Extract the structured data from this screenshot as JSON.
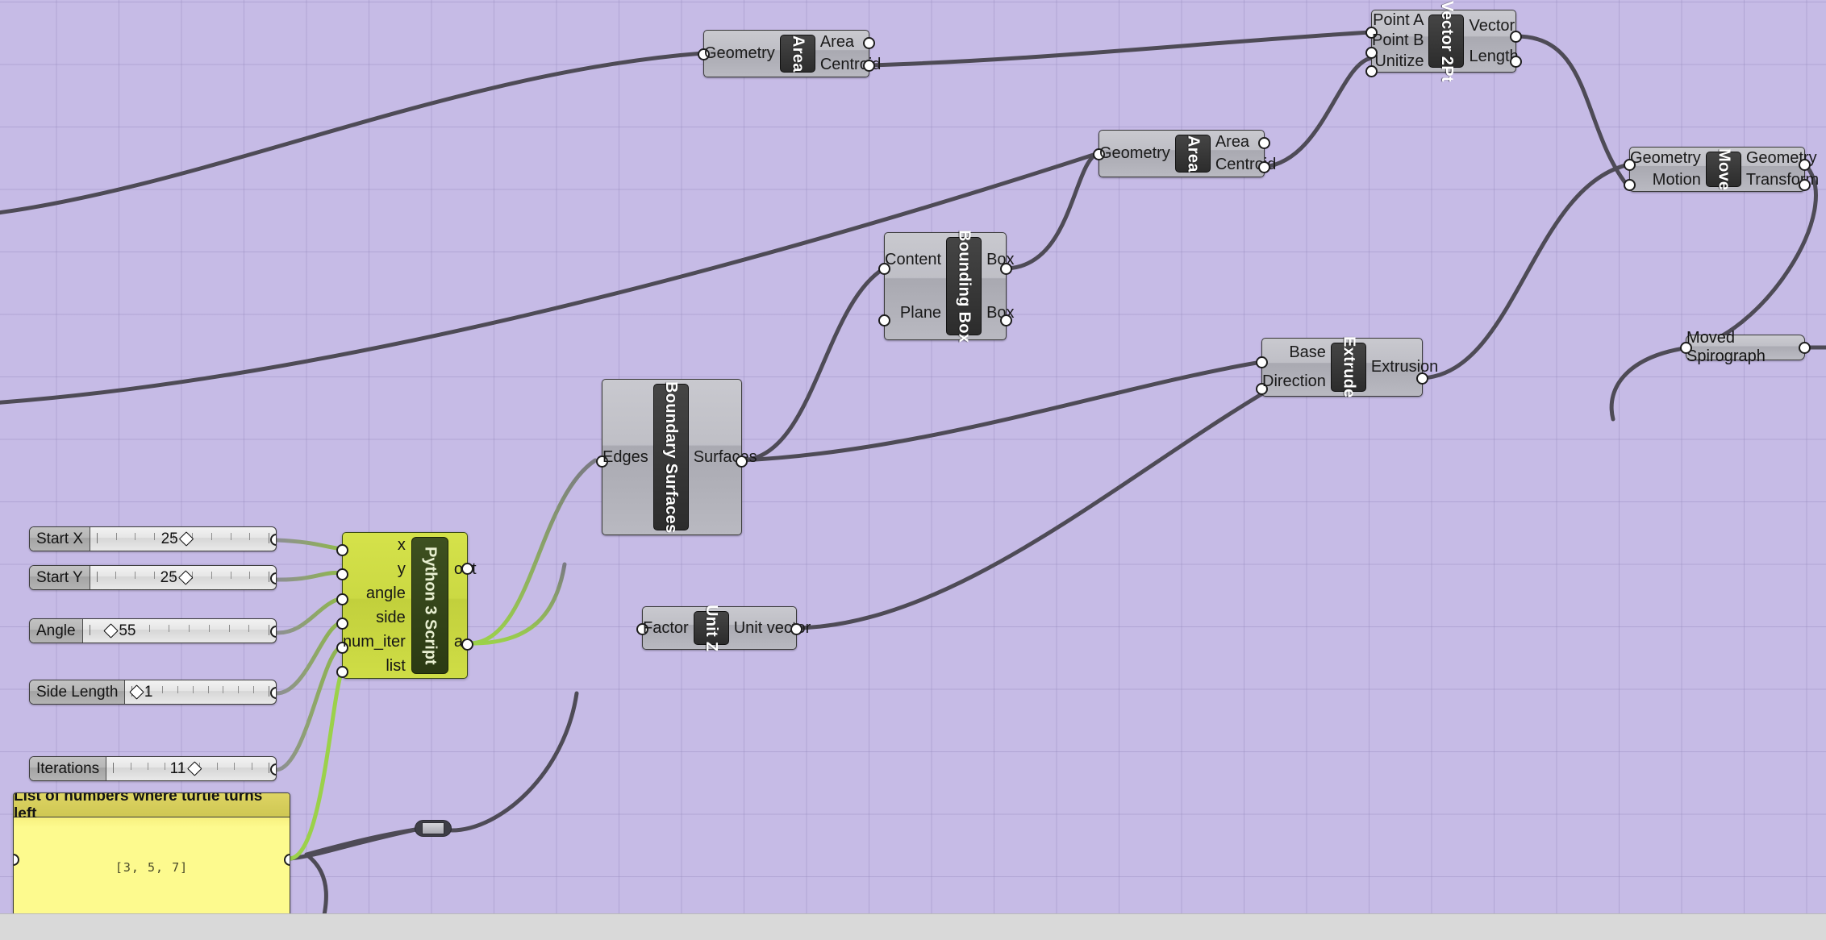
{
  "canvas": {
    "background_color": "#c6bbe6",
    "grid_color": "#968abe",
    "bottom_bar_color": "#d9d9d9",
    "wire_color": "#4e4b56",
    "python_wire_color": "#9bd14a"
  },
  "components": [
    {
      "id": "area1",
      "title": "Area",
      "inputs": [
        "Geometry"
      ],
      "outputs": [
        "Area",
        "Centroid"
      ]
    },
    {
      "id": "area2",
      "title": "Area",
      "inputs": [
        "Geometry"
      ],
      "outputs": [
        "Area",
        "Centroid"
      ]
    },
    {
      "id": "vec2pt",
      "title": "Vector 2Pt",
      "inputs": [
        "Point A",
        "Point B",
        "Unitize"
      ],
      "outputs": [
        "Vector",
        "Length"
      ]
    },
    {
      "id": "move",
      "title": "Move",
      "inputs": [
        "Geometry",
        "Motion"
      ],
      "outputs": [
        "Geometry",
        "Transform"
      ]
    },
    {
      "id": "bbox",
      "title": "Bounding Box",
      "inputs": [
        "Content",
        "Plane"
      ],
      "outputs": [
        "Box",
        "Box"
      ]
    },
    {
      "id": "bsurf",
      "title": "Boundary Surfaces",
      "inputs": [
        "Edges"
      ],
      "outputs": [
        "Surfaces"
      ]
    },
    {
      "id": "extrude",
      "title": "Extrude",
      "inputs": [
        "Base",
        "Direction"
      ],
      "outputs": [
        "Extrusion"
      ]
    },
    {
      "id": "unitz",
      "title": "Unit Z",
      "inputs": [
        "Factor"
      ],
      "outputs": [
        "Unit vector"
      ]
    }
  ],
  "python_component": {
    "title": "Python 3 Script",
    "inputs": [
      "x",
      "y",
      "angle",
      "side",
      "num_iter",
      "list"
    ],
    "outputs": [
      "out",
      "a"
    ]
  },
  "param_capsules": [
    {
      "id": "movedspiro",
      "label": "Moved Spirograph"
    }
  ],
  "sliders": [
    {
      "id": "startx",
      "label": "Start X",
      "value": "25",
      "fraction": 0.5,
      "ticks": 10
    },
    {
      "id": "starty",
      "label": "Start Y",
      "value": "25",
      "fraction": 0.5,
      "ticks": 10
    },
    {
      "id": "angle",
      "label": "Angle",
      "value": "55",
      "fraction": 0.09,
      "ticks": 10
    },
    {
      "id": "sidelen",
      "label": "Side Length",
      "value": "1",
      "fraction": 0.02,
      "ticks": 10
    },
    {
      "id": "iters",
      "label": "Iterations",
      "value": "11",
      "fraction": 0.45,
      "ticks": 10
    }
  ],
  "panel": {
    "title": "List of numbers where turtle turns left",
    "content": "[3, 5, 7]"
  }
}
